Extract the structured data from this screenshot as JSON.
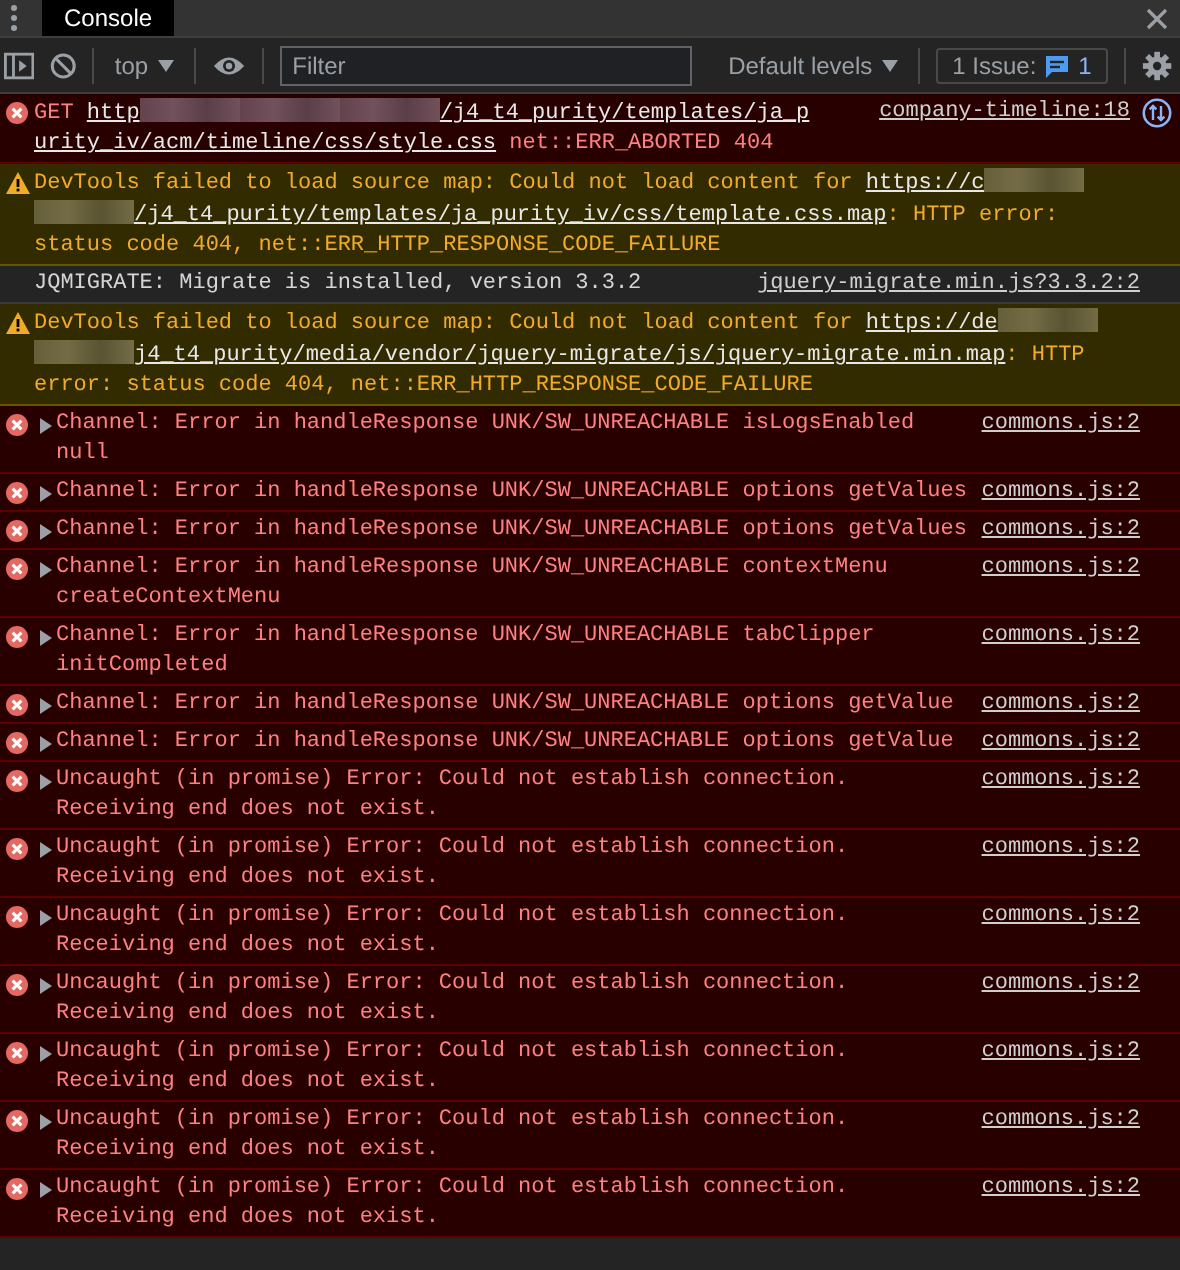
{
  "tab": {
    "label": "Console",
    "selected": true
  },
  "toolbar": {
    "context": "top",
    "filter": {
      "placeholder": "Filter"
    },
    "levels": "Default levels",
    "issues": {
      "label": "1 Issue:",
      "count": "1"
    }
  },
  "messages": [
    {
      "kind": "error",
      "expandable": false,
      "request": true,
      "source": "company-timeline:18",
      "parts": [
        {
          "kind": "text",
          "text": "GET "
        },
        {
          "kind": "link",
          "text": "http"
        },
        {
          "kind": "redacted"
        },
        {
          "kind": "redacted"
        },
        {
          "kind": "redacted"
        },
        {
          "kind": "link",
          "text": "/j4_t4_purity/templates/ja_p"
        },
        {
          "kind": "link",
          "text": "urity_iv/acm/timeline/css/style.css"
        },
        {
          "kind": "text",
          "text": " net::ERR_ABORTED 404"
        }
      ]
    },
    {
      "kind": "warning",
      "expandable": false,
      "request": false,
      "parts": [
        {
          "kind": "text",
          "text": "DevTools failed to load source map: Could not load content for "
        },
        {
          "kind": "link",
          "text": "https://c"
        },
        {
          "kind": "redacted"
        },
        {
          "kind": "redacted"
        },
        {
          "kind": "link",
          "text": "/j4_t4_purity/templates/ja_purity_iv/css/template.css.map"
        },
        {
          "kind": "text",
          "text": ": HTTP error: status code 404, net::ERR_HTTP_RESPONSE_CODE_FAILURE"
        }
      ]
    },
    {
      "kind": "info",
      "expandable": false,
      "request": false,
      "source": "jquery-migrate.min.js?3.3.2:2",
      "parts": [
        {
          "kind": "text",
          "text": "JQMIGRATE: Migrate is installed, version 3.3.2"
        }
      ]
    },
    {
      "kind": "warning",
      "expandable": false,
      "request": false,
      "parts": [
        {
          "kind": "text",
          "text": "DevTools failed to load source map: Could not load content for "
        },
        {
          "kind": "link",
          "text": "https://de"
        },
        {
          "kind": "redacted"
        },
        {
          "kind": "redacted"
        },
        {
          "kind": "link",
          "text": "j4_t4_purity/media/vendor/jquery-migrate/js/jquery-migrate.min.map"
        },
        {
          "kind": "text",
          "text": ": HTTP error: status code 404, net::ERR_HTTP_RESPONSE_CODE_FAILURE"
        }
      ]
    },
    {
      "kind": "error",
      "expandable": true,
      "request": false,
      "source": "commons.js:2",
      "parts": [
        {
          "kind": "text",
          "text": "Channel: Error in handleResponse UNK/SW_UNREACHABLE isLogsEnabled null"
        }
      ]
    },
    {
      "kind": "error",
      "expandable": true,
      "request": false,
      "source": "commons.js:2",
      "parts": [
        {
          "kind": "text",
          "text": "Channel: Error in handleResponse UNK/SW_UNREACHABLE options getValues"
        }
      ]
    },
    {
      "kind": "error",
      "expandable": true,
      "request": false,
      "source": "commons.js:2",
      "parts": [
        {
          "kind": "text",
          "text": "Channel: Error in handleResponse UNK/SW_UNREACHABLE options getValues"
        }
      ]
    },
    {
      "kind": "error",
      "expandable": true,
      "request": false,
      "source": "commons.js:2",
      "parts": [
        {
          "kind": "text",
          "text": "Channel: Error in handleResponse UNK/SW_UNREACHABLE contextMenu createContextMenu"
        }
      ]
    },
    {
      "kind": "error",
      "expandable": true,
      "request": false,
      "source": "commons.js:2",
      "parts": [
        {
          "kind": "text",
          "text": "Channel: Error in handleResponse UNK/SW_UNREACHABLE tabClipper initCompleted"
        }
      ]
    },
    {
      "kind": "error",
      "expandable": true,
      "request": false,
      "source": "commons.js:2",
      "parts": [
        {
          "kind": "text",
          "text": "Channel: Error in handleResponse UNK/SW_UNREACHABLE options getValue"
        }
      ]
    },
    {
      "kind": "error",
      "expandable": true,
      "request": false,
      "source": "commons.js:2",
      "parts": [
        {
          "kind": "text",
          "text": "Channel: Error in handleResponse UNK/SW_UNREACHABLE options getValue"
        }
      ]
    },
    {
      "kind": "error",
      "expandable": true,
      "request": false,
      "source": "commons.js:2",
      "parts": [
        {
          "kind": "text",
          "text": "Uncaught (in promise) Error: Could not establish connection. Receiving end does not exist."
        }
      ]
    },
    {
      "kind": "error",
      "expandable": true,
      "request": false,
      "source": "commons.js:2",
      "parts": [
        {
          "kind": "text",
          "text": "Uncaught (in promise) Error: Could not establish connection. Receiving end does not exist."
        }
      ]
    },
    {
      "kind": "error",
      "expandable": true,
      "request": false,
      "source": "commons.js:2",
      "parts": [
        {
          "kind": "text",
          "text": "Uncaught (in promise) Error: Could not establish connection. Receiving end does not exist."
        }
      ]
    },
    {
      "kind": "error",
      "expandable": true,
      "request": false,
      "source": "commons.js:2",
      "parts": [
        {
          "kind": "text",
          "text": "Uncaught (in promise) Error: Could not establish connection. Receiving end does not exist."
        }
      ]
    },
    {
      "kind": "error",
      "expandable": true,
      "request": false,
      "source": "commons.js:2",
      "parts": [
        {
          "kind": "text",
          "text": "Uncaught (in promise) Error: Could not establish connection. Receiving end does not exist."
        }
      ]
    },
    {
      "kind": "error",
      "expandable": true,
      "request": false,
      "source": "commons.js:2",
      "parts": [
        {
          "kind": "text",
          "text": "Uncaught (in promise) Error: Could not establish connection. Receiving end does not exist."
        }
      ]
    },
    {
      "kind": "error",
      "expandable": true,
      "request": false,
      "source": "commons.js:2",
      "parts": [
        {
          "kind": "text",
          "text": "Uncaught (in promise) Error: Could not establish connection. Receiving end does not exist."
        }
      ]
    }
  ]
}
